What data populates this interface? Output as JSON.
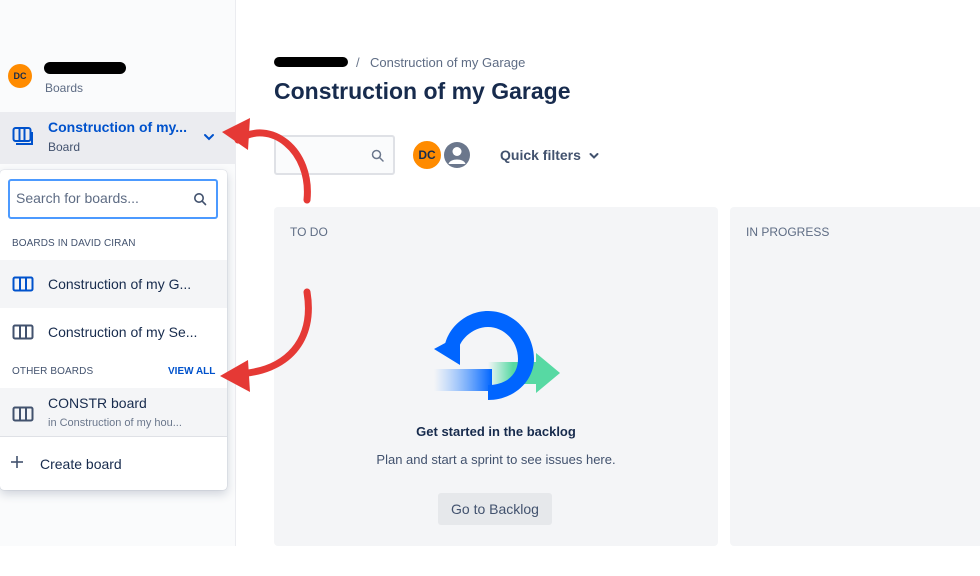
{
  "sidebar": {
    "avatar_initials": "DC",
    "project_subtitle": "Boards",
    "current_board": {
      "title": "Construction of my...",
      "subtitle": "Board"
    }
  },
  "dropdown": {
    "search_placeholder": "Search for boards...",
    "section_project": "BOARDS IN DAVID CIRAN",
    "project_boards": [
      {
        "label": "Construction of my G..."
      },
      {
        "label": "Construction of my Se..."
      }
    ],
    "section_other": "OTHER BOARDS",
    "view_all": "VIEW ALL",
    "other_boards": [
      {
        "label": "CONSTR board",
        "sublabel": "in Construction of my hou..."
      }
    ],
    "create_board": "Create board"
  },
  "main": {
    "breadcrumb": {
      "separator": "/",
      "current": "Construction of my Garage"
    },
    "title": "Construction of my Garage",
    "avatar_initials": "DC",
    "quick_filters": "Quick filters",
    "columns": [
      {
        "title": "TO DO"
      },
      {
        "title": "IN PROGRESS"
      }
    ],
    "empty_state": {
      "heading": "Get started in the backlog",
      "body": "Plan and start a sprint to see issues here.",
      "button": "Go to Backlog"
    }
  },
  "colors": {
    "accent": "#0052cc",
    "avatar": "#ff8b00",
    "annotation_arrow": "#e53935",
    "illustration_blue": "#0065ff",
    "illustration_green": "#57d9a3"
  },
  "icons": [
    "board-icon",
    "chevron-down-icon",
    "search-icon",
    "plus-icon",
    "user-icon",
    "arrow-annotation"
  ]
}
